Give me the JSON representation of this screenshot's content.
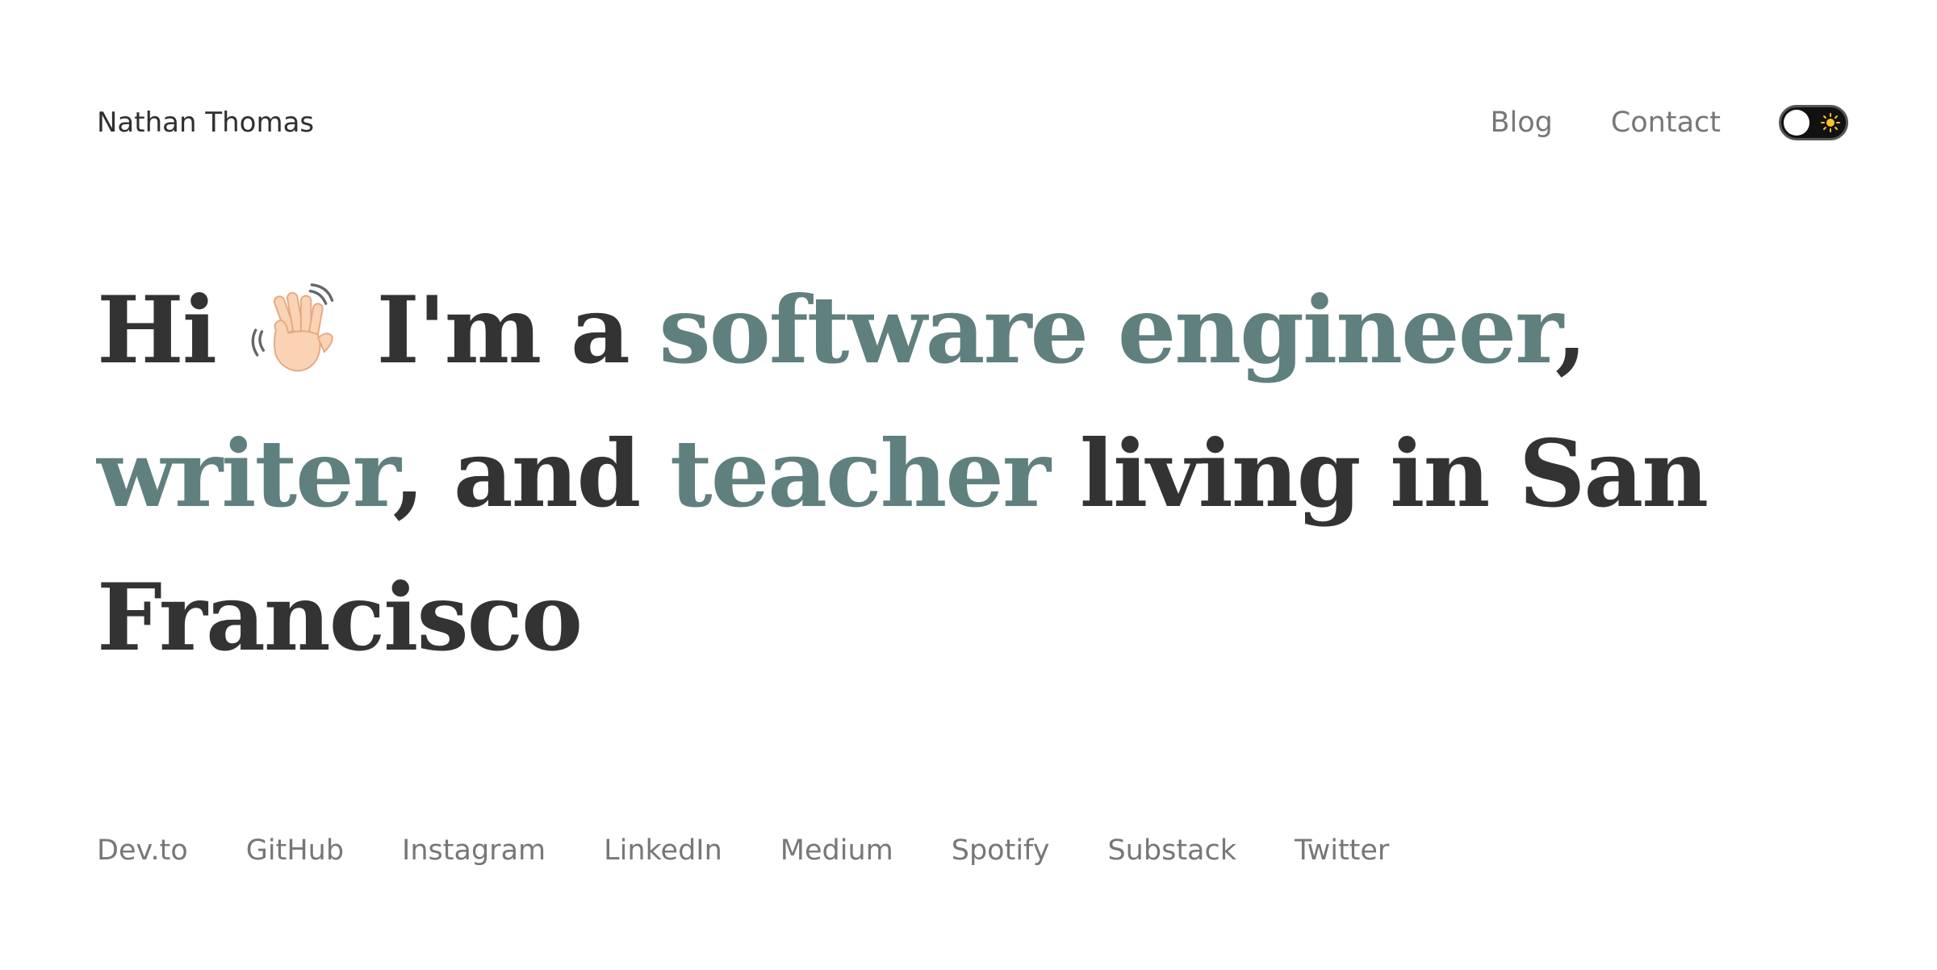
{
  "header": {
    "site_name": "Nathan Thomas",
    "nav": [
      {
        "label": "Blog"
      },
      {
        "label": "Contact"
      }
    ],
    "theme_toggle": {
      "icon": "sun-icon",
      "state": "light"
    }
  },
  "hero": {
    "greeting": "Hi",
    "wave_icon": "waving-hand-icon",
    "intro": "I'm a",
    "role1": "software engineer",
    "sep1": ",",
    "role2": "writer",
    "sep2": ",",
    "and": "and",
    "role3": "teacher",
    "location": "living in San Francisco"
  },
  "social": [
    {
      "label": "Dev.to"
    },
    {
      "label": "GitHub"
    },
    {
      "label": "Instagram"
    },
    {
      "label": "LinkedIn"
    },
    {
      "label": "Medium"
    },
    {
      "label": "Spotify"
    },
    {
      "label": "Substack"
    },
    {
      "label": "Twitter"
    }
  ],
  "colors": {
    "accent": "#5f807e",
    "text": "#333333",
    "muted": "#777777",
    "background": "#ffffff"
  }
}
